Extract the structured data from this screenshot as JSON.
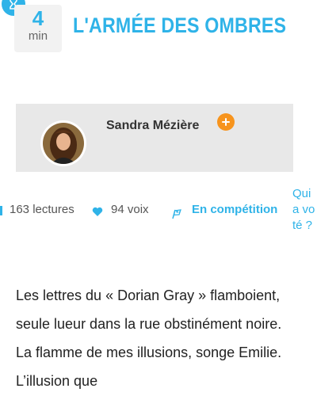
{
  "reading_time": {
    "value": "4",
    "unit": "min",
    "icon": "hourglass-icon"
  },
  "story": {
    "title": "L'ARMÉE DES OMBRES",
    "excerpt": "Les lettres du « Dorian Gray » flamboient, seule lueur dans la rue obstinément noire. La flamme de mes illusions, songe Emilie. L’illusion que"
  },
  "author": {
    "name": "Sandra Mézière",
    "follow_icon": "plus-icon",
    "avatar_icon": "author-avatar"
  },
  "stats": {
    "reads": "163 lectures",
    "votes": "94 voix",
    "status": "En compétition",
    "vote_prompt": "Qui a voté ?"
  },
  "colors": {
    "accent": "#2fb3e8",
    "follow": "#f7941d",
    "card_bg": "#e8e8e8"
  }
}
